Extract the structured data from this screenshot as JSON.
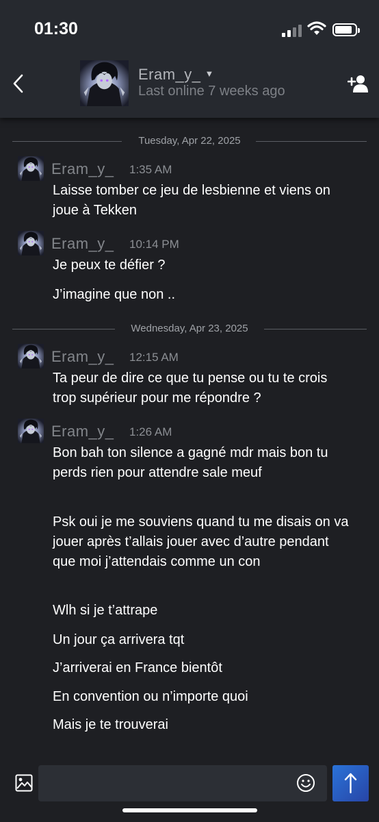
{
  "status_bar": {
    "time": "01:30"
  },
  "header": {
    "name": "Eram_y_",
    "last_online": "Last online 7 weeks ago"
  },
  "icons": {
    "back": "chevron-left-icon",
    "dropdown": "chevron-down-icon",
    "add_friend": "add-friend-icon",
    "image": "image-icon",
    "emoji": "emoji-icon",
    "send": "arrow-up-icon"
  },
  "colors": {
    "background": "#1e1f23",
    "header": "#26292f",
    "sender_name": "#82858a",
    "send_button": "#2a73d8"
  },
  "dates": [
    "Tuesday, Apr 22, 2025",
    "Wednesday, Apr 23, 2025"
  ],
  "groups": [
    {
      "sender": "Eram_y_",
      "time": "1:35 AM",
      "messages": [
        "Laisse tomber ce jeu de lesbienne et viens on joue à Tekken"
      ]
    },
    {
      "sender": "Eram_y_",
      "time": "10:14 PM",
      "messages": [
        "Je peux te défier ?",
        "J’imagine que non .."
      ]
    },
    {
      "sender": "Eram_y_",
      "time": "12:15 AM",
      "messages": [
        "Ta peur de dire ce que tu pense ou tu te crois trop supérieur pour me répondre ?"
      ]
    },
    {
      "sender": "Eram_y_",
      "time": "1:26 AM",
      "messages": [
        "Bon bah ton silence a gagné mdr mais bon tu perds rien pour attendre sale meuf",
        "Psk oui je me souviens quand tu me disais on va jouer après t’allais jouer avec d’autre pendant que moi j’attendais comme un con",
        "Wlh si je t’attrape",
        "Un jour ça arrivera tqt",
        "J’arriverai en France bientôt",
        "En convention ou n’importe quoi",
        "Mais je te trouverai"
      ]
    }
  ]
}
